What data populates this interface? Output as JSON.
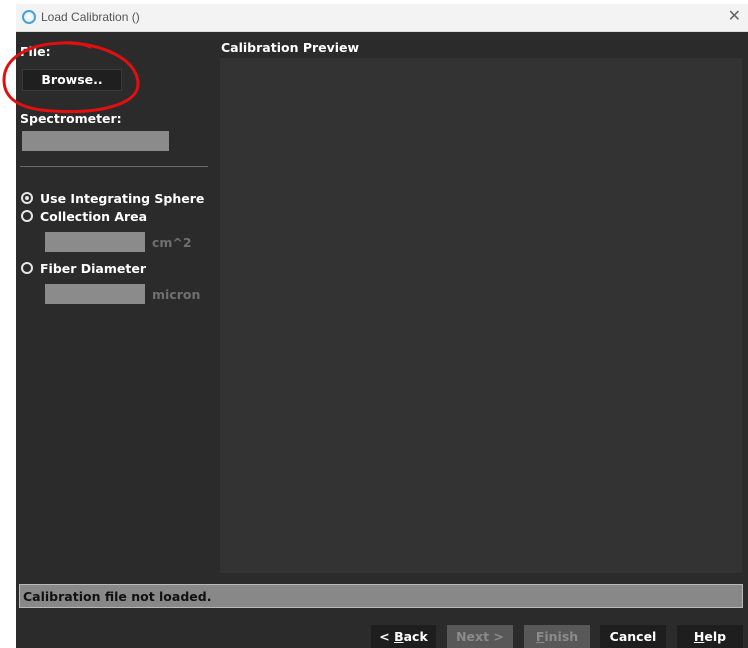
{
  "window": {
    "title": "Load Calibration ()"
  },
  "file": {
    "label": "File:",
    "browse_label": "Browse.."
  },
  "spectrometer": {
    "label": "Spectrometer:",
    "value": ""
  },
  "options": {
    "integrating_sphere": "Use Integrating Sphere",
    "collection_area": "Collection Area",
    "collection_area_unit": "cm^2",
    "collection_area_value": "",
    "fiber_diameter": "Fiber Diameter",
    "fiber_diameter_unit": "micron",
    "fiber_diameter_value": "",
    "selected": "integrating_sphere"
  },
  "preview": {
    "title": "Calibration Preview"
  },
  "status": {
    "text": "Calibration file not loaded."
  },
  "buttons": {
    "back_prefix": "< ",
    "back_key": "B",
    "back_rest": "ack",
    "next": "Next >",
    "finish_key": "F",
    "finish_rest": "inish",
    "cancel": "Cancel",
    "help_key": "H",
    "help_rest": "elp"
  },
  "colors": {
    "background": "#2b2b2b",
    "annotation": "#e01010",
    "disabled_button": "#585858"
  }
}
